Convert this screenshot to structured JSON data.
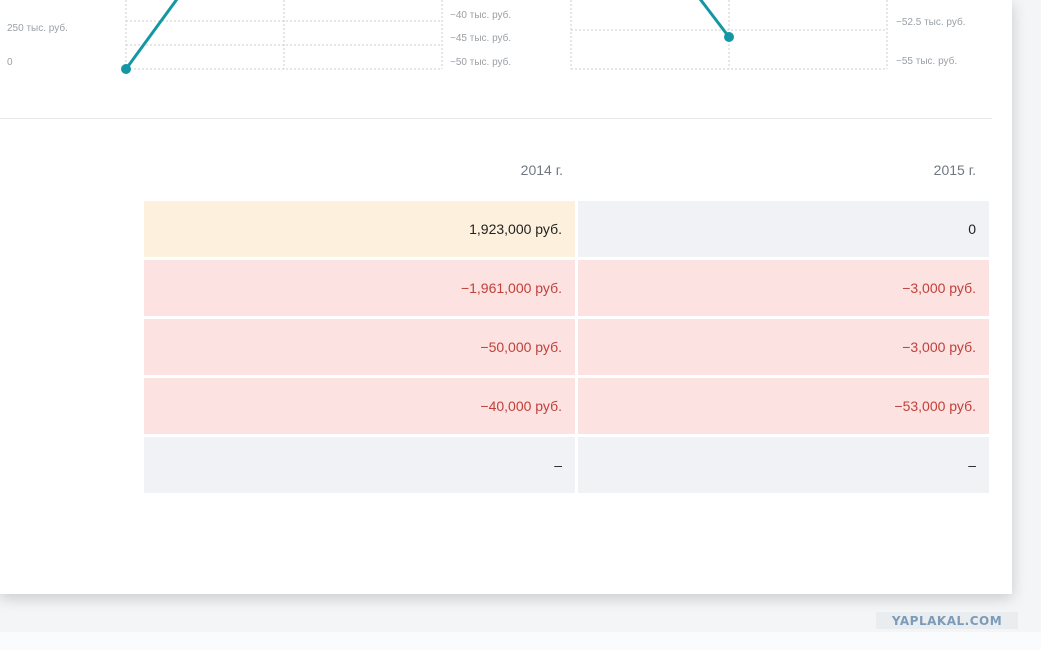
{
  "charts": {
    "left_chart": {
      "left_axis_labels": [
        "250 тыс. руб.",
        "0"
      ],
      "right_axis_labels": [
        "−40 тыс. руб.",
        "−45 тыс. руб.",
        "−50 тыс. руб."
      ],
      "line_color": "#1496a3"
    },
    "right_chart": {
      "right_axis_labels": [
        "−52.5 тыс. руб.",
        "−55 тыс. руб."
      ],
      "line_color": "#1496a3"
    }
  },
  "table": {
    "headers": [
      "2014 г.",
      "2015 г."
    ],
    "rows": [
      {
        "cells": [
          "1,923,000 руб.",
          "0"
        ],
        "styles": [
          "yellow",
          "grey"
        ]
      },
      {
        "cells": [
          "−1,961,000 руб.",
          "−3,000 руб."
        ],
        "styles": [
          "red",
          "red"
        ]
      },
      {
        "cells": [
          "−50,000 руб.",
          "−3,000 руб."
        ],
        "styles": [
          "red",
          "red"
        ]
      },
      {
        "cells": [
          "−40,000 руб.",
          "−53,000 руб."
        ],
        "styles": [
          "red",
          "red"
        ]
      },
      {
        "cells": [
          "–",
          "–"
        ],
        "styles": [
          "grey",
          "grey"
        ]
      }
    ]
  },
  "watermark": "YAPLAKAL.COM",
  "colors": {
    "accent": "#1496a3",
    "negative_text": "#c0413b",
    "positive_cell": "#fdf1de",
    "negative_cell": "#fce2e0",
    "neutral_cell": "#f1f2f6"
  }
}
